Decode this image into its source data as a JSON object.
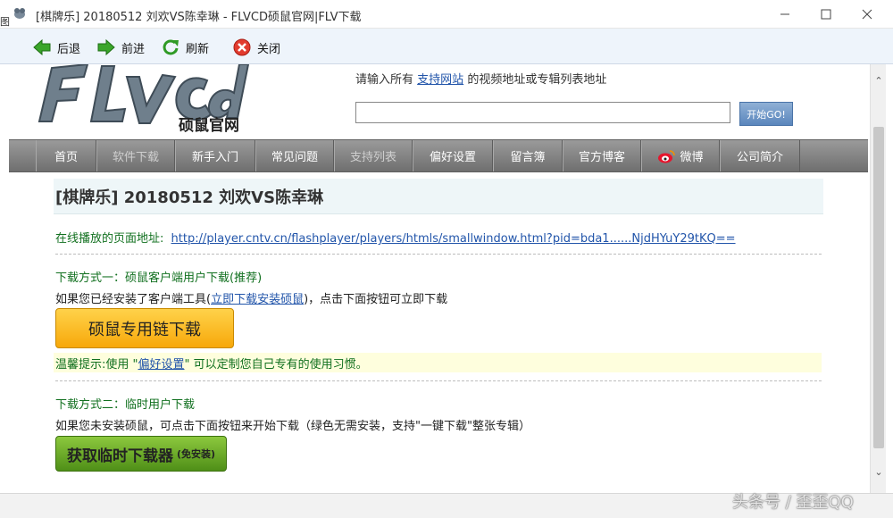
{
  "window": {
    "title": "[棋牌乐] 20180512 刘欢VS陈幸琳 - FLVCD硕鼠官网|FLV下载",
    "edge_glyph": "图"
  },
  "toolbar": {
    "back": "后退",
    "forward": "前进",
    "refresh": "刷新",
    "close": "关闭"
  },
  "header": {
    "logo_sub": "硕鼠官网",
    "hint_prefix": "请输入所有",
    "hint_link": "支持网站",
    "hint_suffix": "的视频地址或专辑列表地址",
    "search_value": "",
    "go_label": "开始GO!"
  },
  "nav": [
    "首页",
    "软件下载",
    "新手入门",
    "常见问题",
    "支持列表",
    "偏好设置",
    "留言簿",
    "官方博客",
    "微博",
    "公司简介"
  ],
  "content": {
    "video_title": "[棋牌乐] 20180512 刘欢VS陈幸琳",
    "page_url_label": "在线播放的页面地址:",
    "page_url": "http://player.cntv.cn/flashplayer/players/htmls/smallwindow.html?pid=bda1......NjdHYuY29tKQ==",
    "method1_title": "下载方式一：硕鼠客户端用户下载(推荐)",
    "method1_desc_prefix": "如果您已经安装了客户端工具(",
    "method1_desc_link": "立即下载安装硕鼠",
    "method1_desc_suffix": ")，点击下面按钮可立即下载",
    "method1_button": "硕鼠专用链下载",
    "tip_prefix": "温馨提示:使用 \"",
    "tip_link": "偏好设置",
    "tip_suffix": "\" 可以定制您自己专有的使用习惯。",
    "method2_title": "下载方式二：临时用户下载",
    "method2_desc": "如果您未安装硕鼠，可点击下面按钮来开始下载（绿色无需安装，支持\"一键下载\"整张专辑）",
    "method2_button": "获取临时下载器",
    "method2_button_small": "(免安装)"
  },
  "watermark": "头条号 / 歪歪QQ",
  "colors": {
    "toolbar_bg": "#eef4fb",
    "nav_bg": "#7f7f7f",
    "accent_link": "#2255aa",
    "green_text": "#11701f",
    "orange_button": "#f7a80a",
    "green_button": "#4f8f18"
  }
}
